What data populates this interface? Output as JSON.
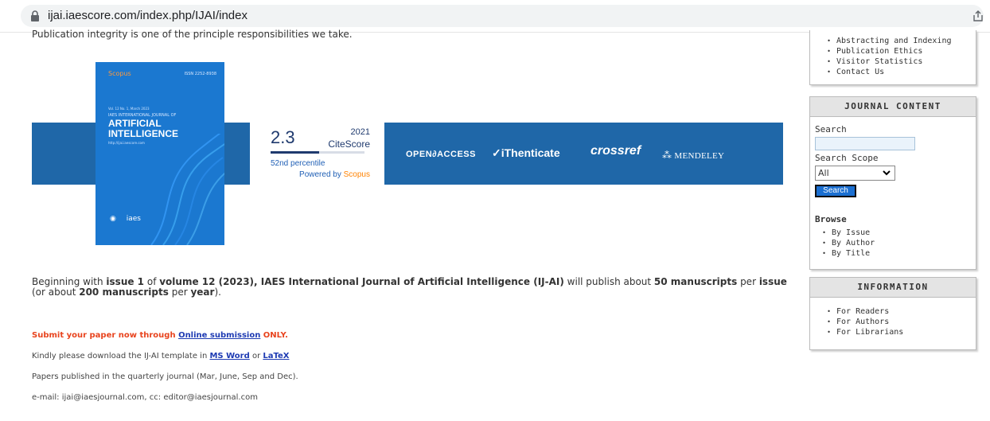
{
  "browser": {
    "url": "ijai.iaescore.com/index.php/IJAI/index",
    "icons": [
      "lock-icon",
      "share-icon"
    ]
  },
  "main": {
    "intro": "Publication integrity is one of the principle responsibilities we take.",
    "cover": {
      "scopus": "Scopus",
      "issn": "ISSN 2252-8938",
      "volume": "Vol. 12 No. 1, March 2023",
      "journal": "IAES INTERNATIONAL JOURNAL OF",
      "title_line1": "ARTIFICIAL",
      "title_line2": "INTELLIGENCE",
      "url": "http://ijai.iaescore.com",
      "publisher": "iaes"
    },
    "citescore": {
      "value": "2.3",
      "label": "CiteScore",
      "year": "2021",
      "percentile_value": 52,
      "percentile": "52nd percentile",
      "powered": "Powered by ",
      "powered_brand": "Scopus"
    },
    "indexers": {
      "open_access": "OPEN∂ACCESS",
      "ithenticate": "✓iThenticate",
      "crossref": "crossref",
      "mendeley": "MENDELEY"
    },
    "para": {
      "t1": "Beginning with ",
      "b1": "issue 1",
      "t2": " of ",
      "b2": "volume 12 (2023), IAES International Journal of Artificial Intelligence (IJ-AI)",
      "t3": " will publish about ",
      "b3": "50 manuscripts",
      "t4": " per ",
      "b4": "issue",
      "t5": " (or about ",
      "b5": "200 manuscripts",
      "t6": " per ",
      "b6": "year",
      "t7": ")."
    },
    "submit": {
      "prefix": "Submit your paper now through ",
      "link": "Online submission",
      "suffix": " ONLY."
    },
    "template": {
      "prefix": "Kindly please download the IJ-AI template in ",
      "word": "MS Word",
      "or": " or ",
      "latex": "LaTeX"
    },
    "schedule": "Papers published in the quarterly journal (Mar, June, Sep and Dec).",
    "email": "e-mail: ijai@iaesjournal.com, cc: editor@iaesjournal.com"
  },
  "sidebar": {
    "top_links": [
      "Abstracting and Indexing",
      "Publication Ethics",
      "Visitor Statistics",
      "Contact Us"
    ],
    "journal_content": {
      "heading": "JOURNAL CONTENT",
      "search_label": "Search",
      "search_value": "",
      "scope_label": "Search Scope",
      "scope_value": "All",
      "search_button": "Search",
      "browse_label": "Browse",
      "browse_links": [
        "By Issue",
        "By Author",
        "By Title"
      ]
    },
    "information": {
      "heading": "INFORMATION",
      "links": [
        "For Readers",
        "For Authors",
        "For Librarians"
      ]
    }
  },
  "colors": {
    "banner_blue": "#1f67a8",
    "cover_blue": "#1b78d0",
    "submit_red": "#e8431d",
    "link_blue": "#1e3bb3",
    "button_blue": "#1b6fd1"
  }
}
